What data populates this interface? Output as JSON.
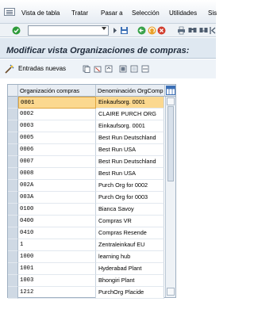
{
  "menu": {
    "items": [
      "Vista de tabla",
      "Tratar",
      "Pasar a",
      "Selección",
      "Utilidades",
      "Sis"
    ]
  },
  "toolbar": {
    "command_field_value": "",
    "icons": [
      "enter-icon",
      "save-icon",
      "back-icon",
      "exit-icon",
      "cancel-icon",
      "print-icon",
      "find-icon",
      "find-next-icon"
    ]
  },
  "page": {
    "title": "Modificar vista Organizaciones de compras:"
  },
  "app_toolbar": {
    "new_entries_label": "Entradas nuevas",
    "icons": [
      "copy-icon",
      "delete-icon",
      "undo-icon",
      "select-all-icon",
      "deselect-icon",
      "block-icon"
    ]
  },
  "table": {
    "headers": [
      "Organización compras",
      "Denominación OrgComp"
    ],
    "rows": [
      {
        "org": "0001",
        "name": "Einkaufsorg. 0001",
        "selected": true
      },
      {
        "org": "0002",
        "name": "CLAIRE PURCH ORG"
      },
      {
        "org": "0003",
        "name": "Einkaufsorg. 0001"
      },
      {
        "org": "0005",
        "name": "Best Run Deutschland"
      },
      {
        "org": "0006",
        "name": "Best Run USA"
      },
      {
        "org": "0007",
        "name": "Best Run Deutschland"
      },
      {
        "org": "0008",
        "name": "Best Run USA"
      },
      {
        "org": "002A",
        "name": "Purch Org for 0002"
      },
      {
        "org": "003A",
        "name": "Purch Org for 0003"
      },
      {
        "org": "0100",
        "name": "Bianca Savoy"
      },
      {
        "org": "0400",
        "name": "Compras VR"
      },
      {
        "org": "0410",
        "name": "Compras Resende"
      },
      {
        "org": "1",
        "name": "Zentraleinkauf EU"
      },
      {
        "org": "1000",
        "name": "learning hub"
      },
      {
        "org": "1001",
        "name": "Hyderabad Plant"
      },
      {
        "org": "1003",
        "name": "Bhongiri Plant"
      },
      {
        "org": "1212",
        "name": "PurchOrg Placide"
      }
    ]
  },
  "colors": {
    "selected_row": "#fbd88f",
    "title_bar": "#dfe8f1"
  }
}
